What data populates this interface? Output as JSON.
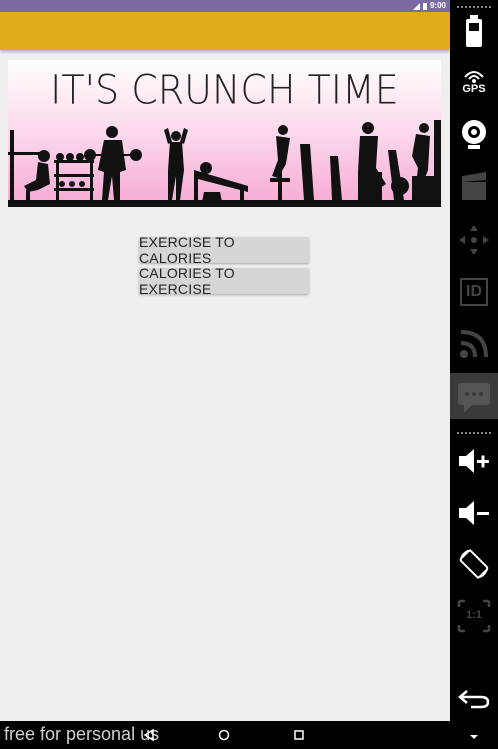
{
  "status_bar": {
    "time": "9:00"
  },
  "banner": {
    "title": "IT'S CRUNCH TIME"
  },
  "buttons": {
    "exercise_to_calories": "EXERCISE TO CALORIES",
    "calories_to_exercise": "CALORIES TO EXERCISE"
  },
  "watermark": "free for personal us",
  "colors": {
    "status_bar": "#7b6aa2",
    "app_bar": "#e1ab1c",
    "background": "#efefef",
    "button": "#d6d6d6",
    "banner_pink": "#f6a9d3"
  },
  "side_toolbar": {
    "gps_label": "GPS",
    "id_label": "ID",
    "scale_label": "1:1",
    "icons": [
      "battery-icon",
      "gps-icon",
      "webcam-icon",
      "video-clapper-icon",
      "dpad-icon",
      "id-icon",
      "rss-icon",
      "sms-icon",
      "volume-up-icon",
      "volume-down-icon",
      "rotate-icon",
      "scale-icon",
      "back-icon"
    ]
  }
}
